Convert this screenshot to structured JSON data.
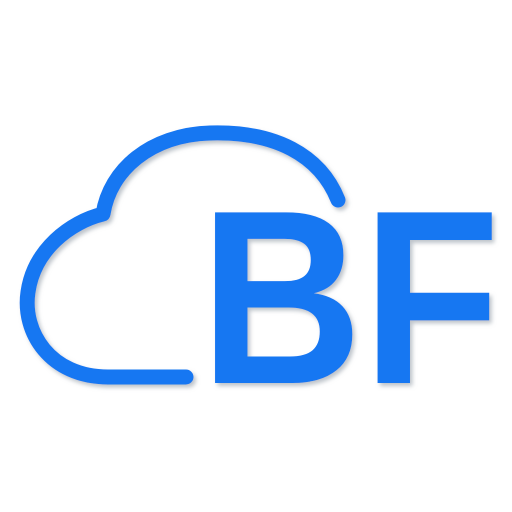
{
  "logo": {
    "text": "BF",
    "color": "#1877f2",
    "shadow_color": "#9aa3ad",
    "background": "#ffffff"
  }
}
